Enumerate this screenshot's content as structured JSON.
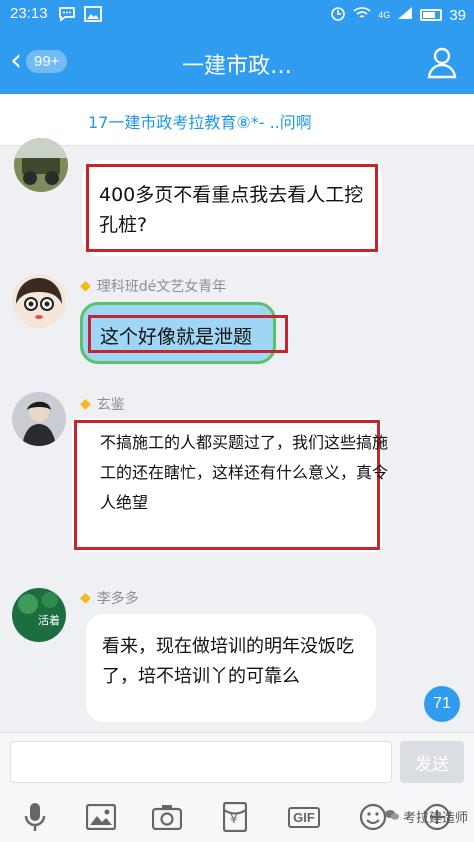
{
  "status": {
    "time": "23:13",
    "battery": "39",
    "signal": "4G"
  },
  "nav": {
    "back_badge": "99+",
    "title": "一建市政…"
  },
  "group": {
    "subtitle": "17一建市政考拉教育⑧*-          ..问啊"
  },
  "messages": [
    {
      "sender": "",
      "text": "400多页不看重点我去看人工挖孔桩?"
    },
    {
      "sender": "理科班dé文艺女青年",
      "text": "这个好像就是泄题"
    },
    {
      "sender": "玄鉴",
      "text": "不搞施工的人都买题过了，我们这些搞施工的还在瞎忙，这样还有什么意义，真令人绝望"
    },
    {
      "sender": "李多多",
      "text": "看来，现在做培训的明年没饭吃了，培不培训丫的可靠么",
      "avatar_caption": "活着"
    }
  ],
  "unread_count": "71",
  "composer": {
    "placeholder": "",
    "send_label": "发送"
  },
  "toolbar": {
    "items": [
      "mic-icon",
      "image-icon",
      "camera-icon",
      "red-packet-icon",
      "gif-icon",
      "emoji-icon",
      "plus-icon"
    ],
    "gif_label": "GIF",
    "red_packet_label": "¥"
  },
  "watermark": {
    "text": "考拉建造师"
  },
  "colors": {
    "accent": "#2f9cf0",
    "highlight": "#c1272d",
    "bubble_selected": "#9fd6f5"
  }
}
